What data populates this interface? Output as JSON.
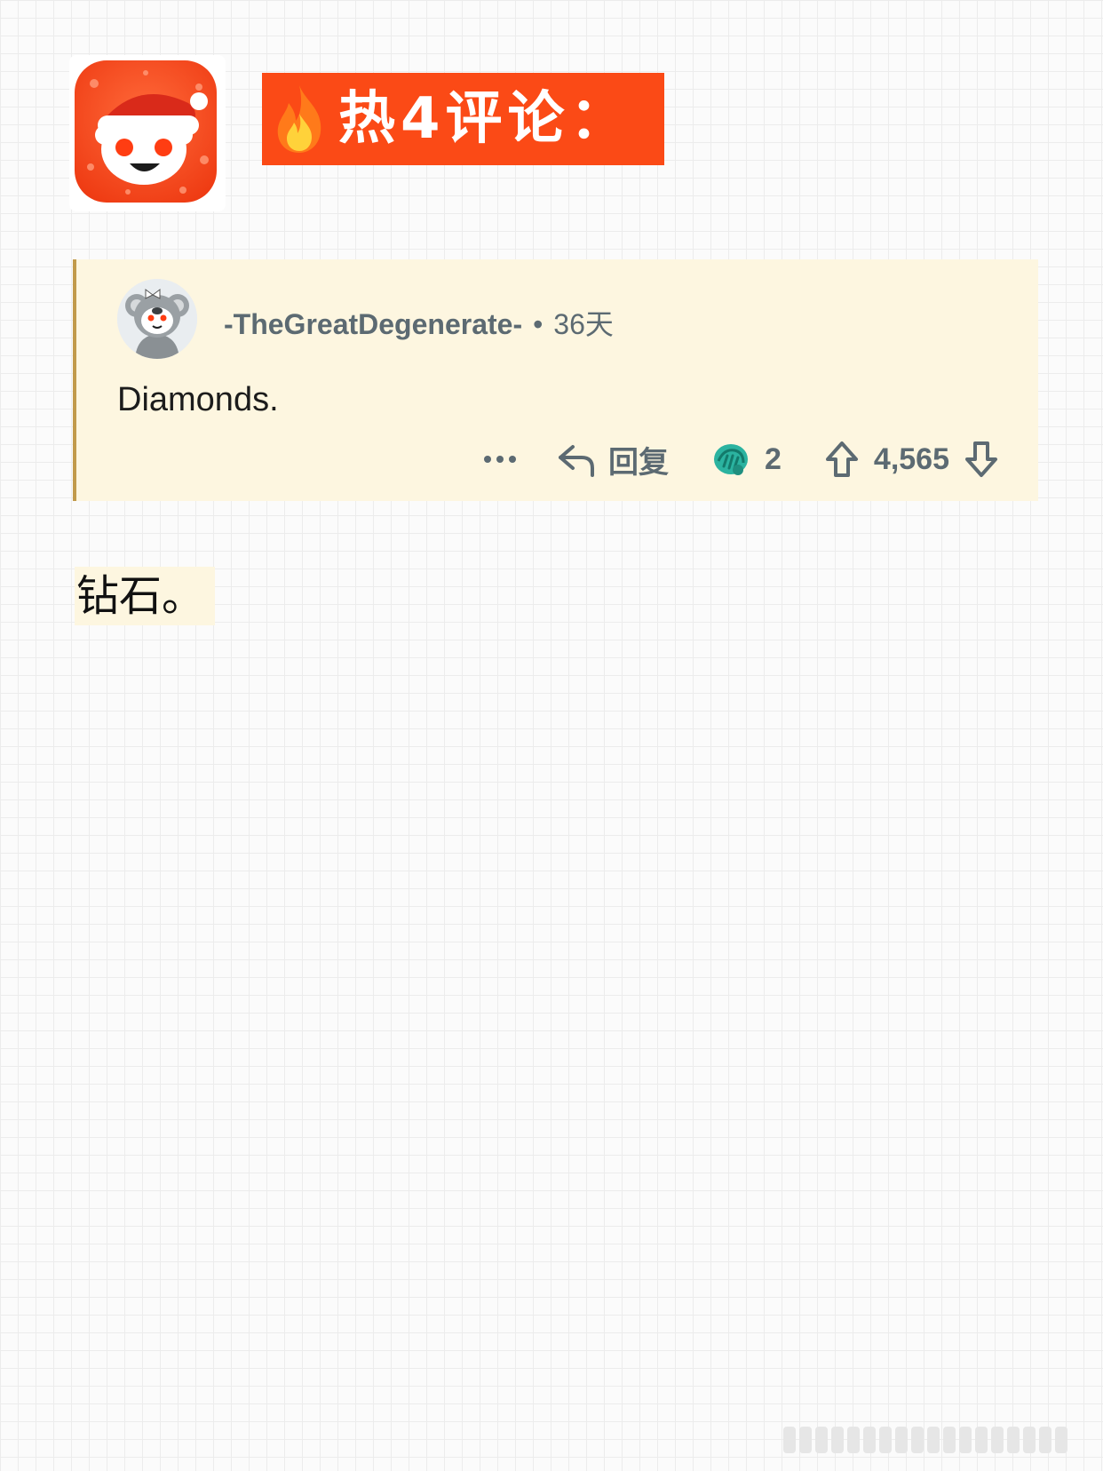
{
  "header": {
    "title": "热4评论：",
    "app_icon": "reddit-santa-icon",
    "badge_icon": "fire-icon",
    "banner_color": "#fb4a16"
  },
  "comment": {
    "username": "-TheGreatDegenerate-",
    "separator": "•",
    "age": "36天",
    "body": "Diamonds.",
    "actions": {
      "more_icon": "more-dots-icon",
      "reply_icon": "reply-arrow-icon",
      "reply_label": "回复",
      "award_icon": "award-hands-icon",
      "award_count": "2",
      "upvote_icon": "upvote-arrow-icon",
      "score": "4,565",
      "downvote_icon": "downvote-arrow-icon"
    }
  },
  "translation": {
    "text": "钻石。"
  },
  "colors": {
    "accent": "#fb4a16",
    "card_background": "#fdf6e0",
    "card_border": "#c19a4b",
    "muted_text": "#5c6a72"
  }
}
